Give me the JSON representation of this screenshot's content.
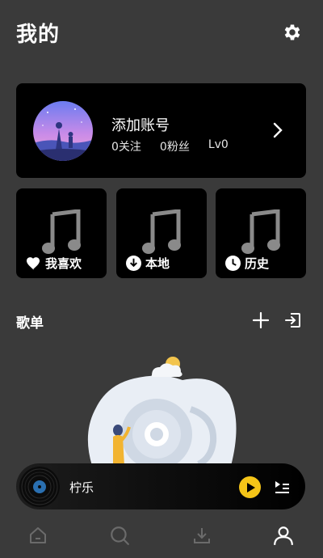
{
  "header": {
    "title": "我的",
    "settings_icon": "gear-icon"
  },
  "profile": {
    "name": "添加账号",
    "following": "0关注",
    "followers": "0粉丝",
    "level": "Lv0",
    "arrow_icon": "chevron-right-icon"
  },
  "quick_access": [
    {
      "label": "我喜欢",
      "icon": "heart-icon"
    },
    {
      "label": "本地",
      "icon": "download-circle-icon"
    },
    {
      "label": "历史",
      "icon": "clock-icon"
    }
  ],
  "playlists": {
    "title": "歌单",
    "add_icon": "plus-icon",
    "import_icon": "import-icon"
  },
  "player": {
    "song": "柠乐",
    "play_icon": "play-icon",
    "queue_icon": "playlist-icon"
  },
  "nav": [
    {
      "name": "home",
      "icon": "home-icon",
      "active": false
    },
    {
      "name": "search",
      "icon": "search-icon",
      "active": false
    },
    {
      "name": "download",
      "icon": "download-icon",
      "active": false
    },
    {
      "name": "profile",
      "icon": "user-icon",
      "active": true
    }
  ],
  "colors": {
    "background": "#3a3a3a",
    "card": "#000000",
    "accent": "#f5c518",
    "muted_icon": "#6b6b6b"
  }
}
